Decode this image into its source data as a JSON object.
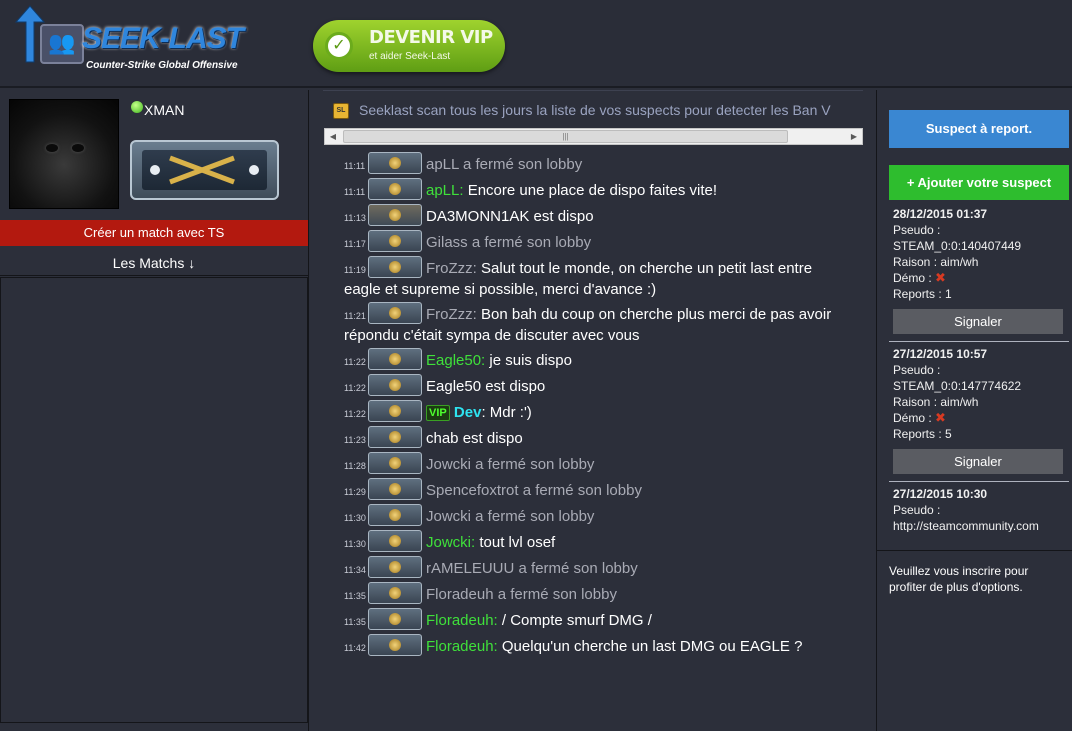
{
  "header": {
    "brand": "SEEK-LAST",
    "tagline": "Counter-Strike Global Offensive",
    "vip_button": {
      "line1": "DEVENIR VIP",
      "line2": "et aider Seek-Last",
      "icon": "check-icon"
    },
    "accent_color": "#2f86dd"
  },
  "profile": {
    "username": "XMAN",
    "status": "online",
    "create_match_label": "Créer un match avec TS",
    "matches_label": "Les Matchs ↓"
  },
  "ticker": {
    "text": "Seeklast scan tous les jours la liste de vos suspects pour detecter les Ban V"
  },
  "chat": {
    "messages": [
      {
        "time": "11:11",
        "author": "",
        "text": "apLL a fermé son lobby",
        "type": "system"
      },
      {
        "time": "11:11",
        "author": "apLL:",
        "text": " Encore une place de dispo faites vite!",
        "type": "chat"
      },
      {
        "time": "11:13",
        "author": "",
        "text": "DA3MONN1AK est dispo",
        "type": "avail",
        "rank": "gun"
      },
      {
        "time": "11:17",
        "author": "",
        "text": "Gilass a fermé son lobby",
        "type": "system"
      },
      {
        "time": "11:19",
        "author": "FroZzz:",
        "text": " Salut tout le monde, on cherche un petit last entre eagle et supreme si possible, merci d'avance :)",
        "type": "chat-grey"
      },
      {
        "time": "11:21",
        "author": "FroZzz:",
        "text": " Bon bah du coup on cherche plus merci de pas avoir répondu c'était sympa de discuter avec vous",
        "type": "chat-grey"
      },
      {
        "time": "11:22",
        "author": "Eagle50:",
        "text": " je suis dispo",
        "type": "chat"
      },
      {
        "time": "11:22",
        "author": "",
        "text": "Eagle50 est dispo",
        "type": "avail"
      },
      {
        "time": "11:22",
        "author": "Dev",
        "text": ": Mdr :')",
        "type": "vip",
        "badge": "VIP"
      },
      {
        "time": "11:23",
        "author": "",
        "text": "chab est dispo",
        "type": "avail"
      },
      {
        "time": "11:28",
        "author": "",
        "text": "Jowcki a fermé son lobby",
        "type": "system"
      },
      {
        "time": "11:29",
        "author": "",
        "text": "Spencefoxtrot a fermé son lobby",
        "type": "system"
      },
      {
        "time": "11:30",
        "author": "",
        "text": "Jowcki a fermé son lobby",
        "type": "system"
      },
      {
        "time": "11:30",
        "author": "Jowcki:",
        "text": " tout lvl osef",
        "type": "chat"
      },
      {
        "time": "11:34",
        "author": "",
        "text": "rAMELEUUU a fermé son lobby",
        "type": "system"
      },
      {
        "time": "11:35",
        "author": "",
        "text": "Floradeuh a fermé son lobby",
        "type": "system"
      },
      {
        "time": "11:35",
        "author": "Floradeuh:",
        "text": " / Compte smurf DMG /",
        "type": "chat"
      },
      {
        "time": "11:42",
        "author": "Floradeuh:",
        "text": " Quelqu'un cherche un last DMG ou EAGLE ?",
        "type": "chat"
      }
    ]
  },
  "sidebar": {
    "suspect_button": "Suspect à report.",
    "add_button": "+ Ajouter votre suspect",
    "reports": [
      {
        "date": "28/12/2015 01:37",
        "pseudo_label": "Pseudo :",
        "pseudo": "STEAM_0:0:140407449",
        "reason": "Raison : aim/wh",
        "demo_label": "Démo :",
        "reports": "Reports : 1",
        "signal": "Signaler"
      },
      {
        "date": "27/12/2015 10:57",
        "pseudo_label": "Pseudo :",
        "pseudo": "STEAM_0:0:147774622",
        "reason": "Raison : aim/wh",
        "demo_label": "Démo :",
        "reports": "Reports : 5",
        "signal": "Signaler"
      },
      {
        "date": "27/12/2015 10:30",
        "pseudo_label": "Pseudo :",
        "pseudo": "http://steamcommunity.com",
        "reason": "",
        "demo_label": "",
        "reports": "",
        "signal": ""
      }
    ],
    "register_text": "Veuillez vous inscrire pour profiter de plus d'options."
  }
}
